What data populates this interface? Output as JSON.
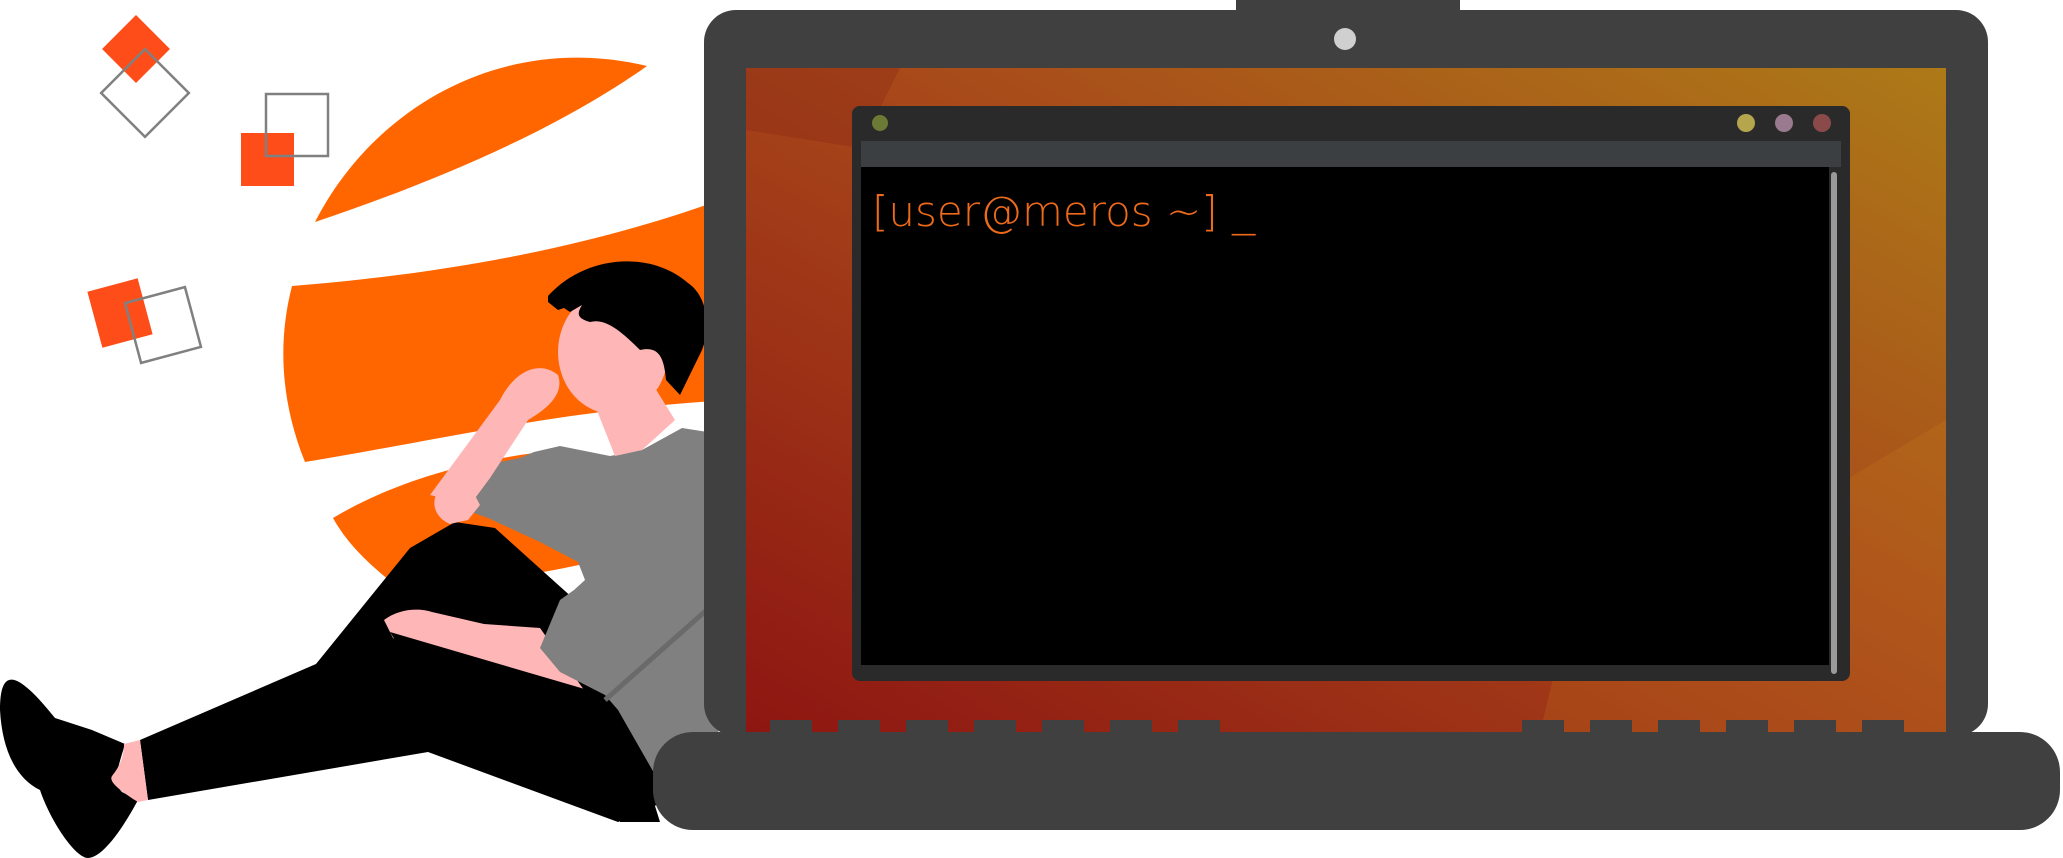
{
  "terminal": {
    "prompt": "[user@meros ~]",
    "cursor": "_",
    "window_buttons": [
      "minimize",
      "maximize",
      "close"
    ]
  },
  "colors": {
    "accent_orange": "#ff6600",
    "accent_red": "#ff4d1a",
    "prompt_text": "#ee6a1a",
    "laptop_body": "#404040",
    "terminal_bg": "#000000",
    "titlebar": "#2a2a2a",
    "skin": "#ffb6b6",
    "shirt": "#808080"
  },
  "icons": [
    "square-icon",
    "outline-square-icon",
    "webcam-icon",
    "laptop-illustration",
    "person-illustration"
  ]
}
